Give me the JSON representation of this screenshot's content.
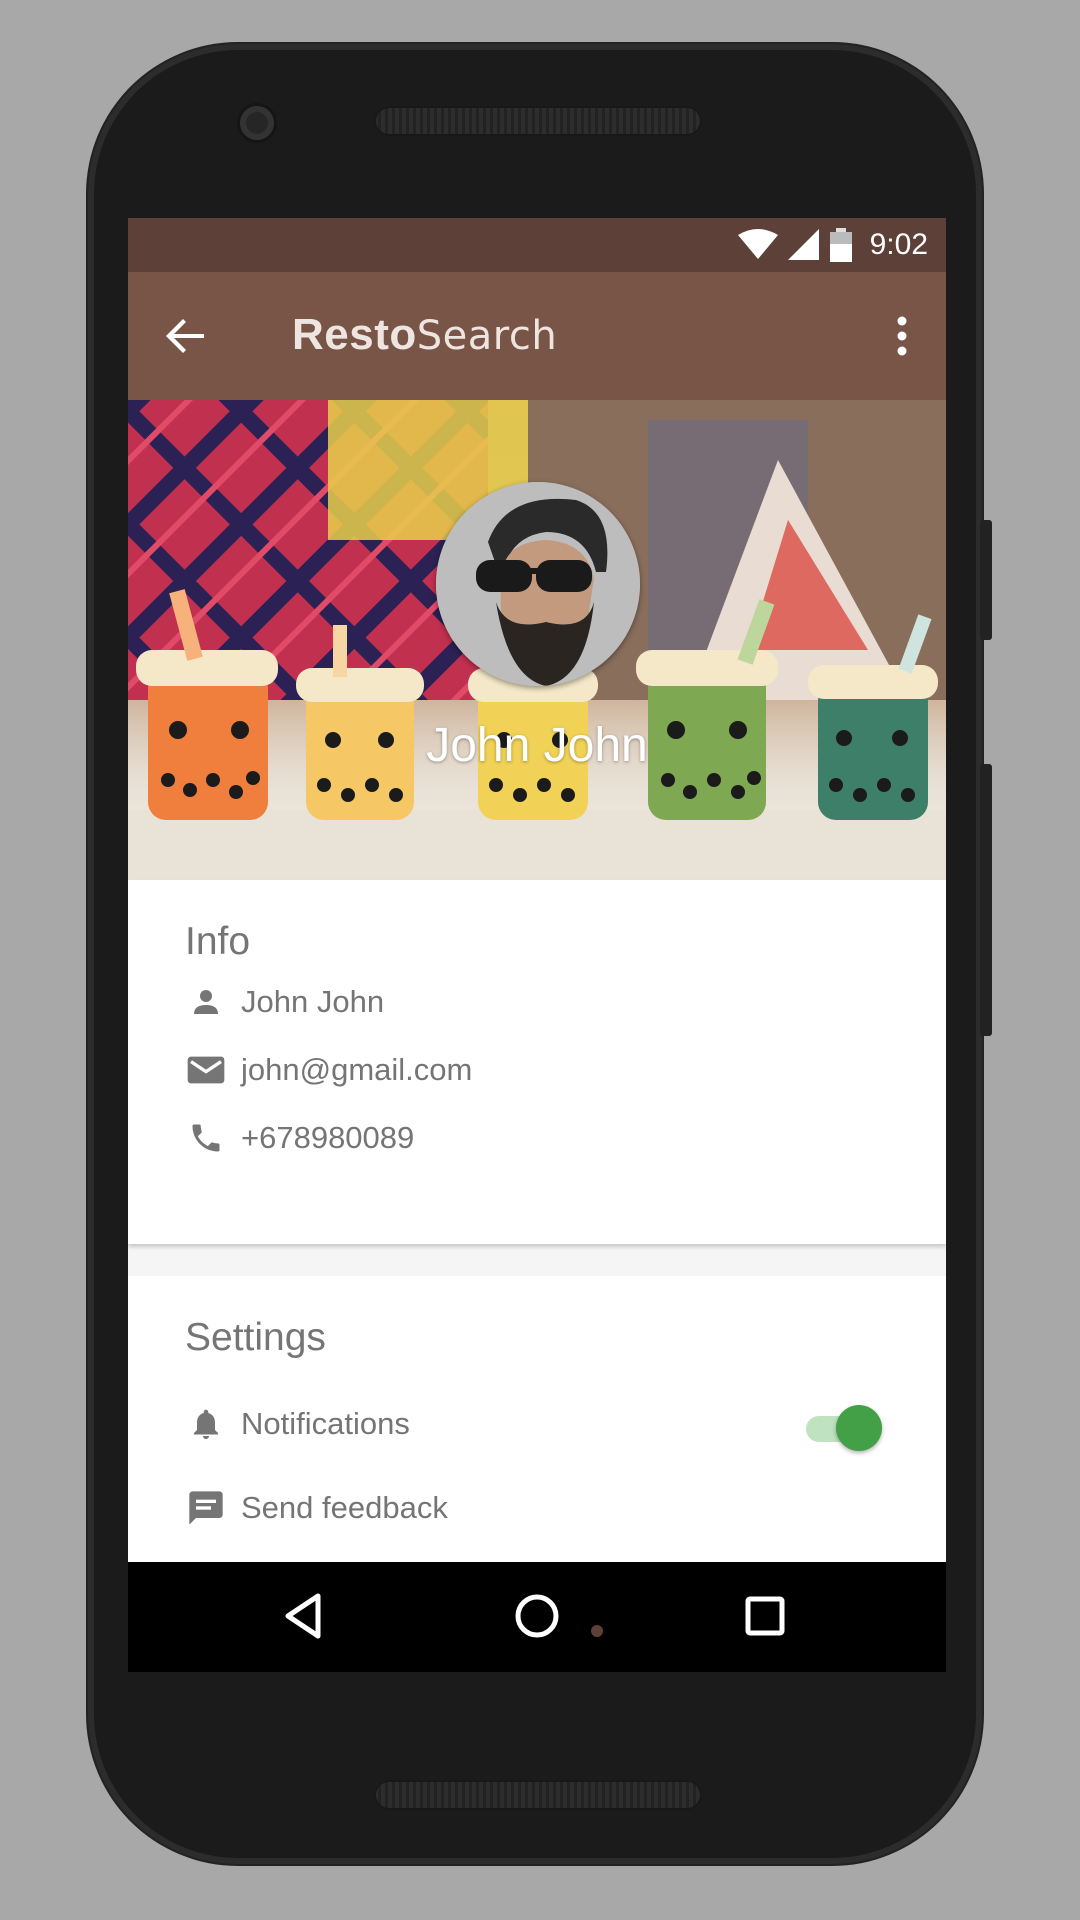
{
  "status_bar": {
    "time": "9:02",
    "icons": [
      "wifi-icon",
      "cell-signal-icon",
      "battery-icon"
    ]
  },
  "app_bar": {
    "title_bold": "Resto",
    "title_light": "Search",
    "back_icon": "arrow-back-icon",
    "menu_icon": "more-vert-icon"
  },
  "header": {
    "name": "John John"
  },
  "info": {
    "title": "Info",
    "items": [
      {
        "icon": "person-icon",
        "text": "John John"
      },
      {
        "icon": "email-icon",
        "text": "john@gmail.com"
      },
      {
        "icon": "phone-icon",
        "text": "+678980089"
      }
    ]
  },
  "settings": {
    "title": "Settings",
    "items": [
      {
        "icon": "bell-icon",
        "text": "Notifications",
        "toggle_on": true
      },
      {
        "icon": "feedback-icon",
        "text": "Send feedback"
      }
    ]
  },
  "colors": {
    "status_bar": "#5d4037",
    "app_bar": "#795548",
    "toggle_on": "#43a047"
  }
}
